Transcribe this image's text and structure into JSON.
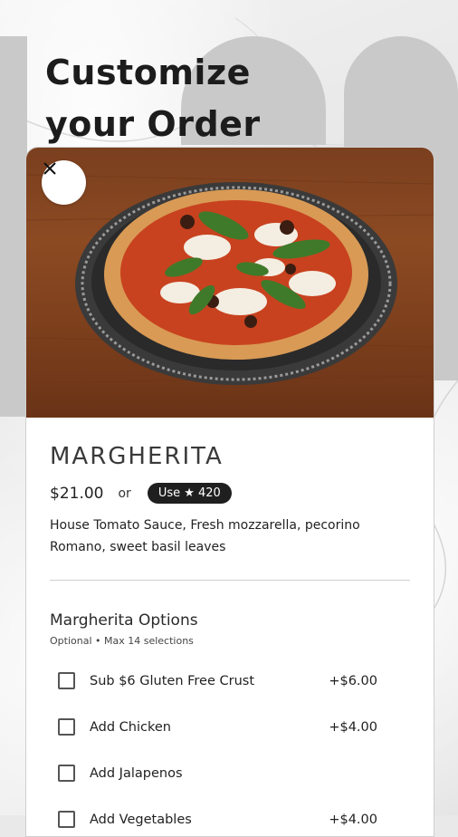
{
  "page": {
    "title": "Customize your Order",
    "title_line1": "Customize",
    "title_line2": "your Order"
  },
  "item": {
    "name": "MARGHERITA",
    "price": "$21.00",
    "or_text": "or",
    "points_label": "Use ★ 420",
    "description": "House Tomato Sauce, Fresh mozzarella, pecorino Romano, sweet basil leaves"
  },
  "options": {
    "title": "Margherita Options",
    "subtitle": "Optional • Max 14 selections",
    "items": [
      {
        "label": "Sub $6 Gluten Free Crust",
        "price": "+$6.00"
      },
      {
        "label": "Add Chicken",
        "price": "+$4.00"
      },
      {
        "label": "Add Jalapenos",
        "price": ""
      },
      {
        "label": "Add Vegetables",
        "price": "+$4.00"
      }
    ]
  },
  "icons": {
    "close": "close-icon"
  },
  "colors": {
    "badge_bg": "#1f1f1f",
    "title_text": "#1c1c1c",
    "card_bg": "#ffffff"
  }
}
